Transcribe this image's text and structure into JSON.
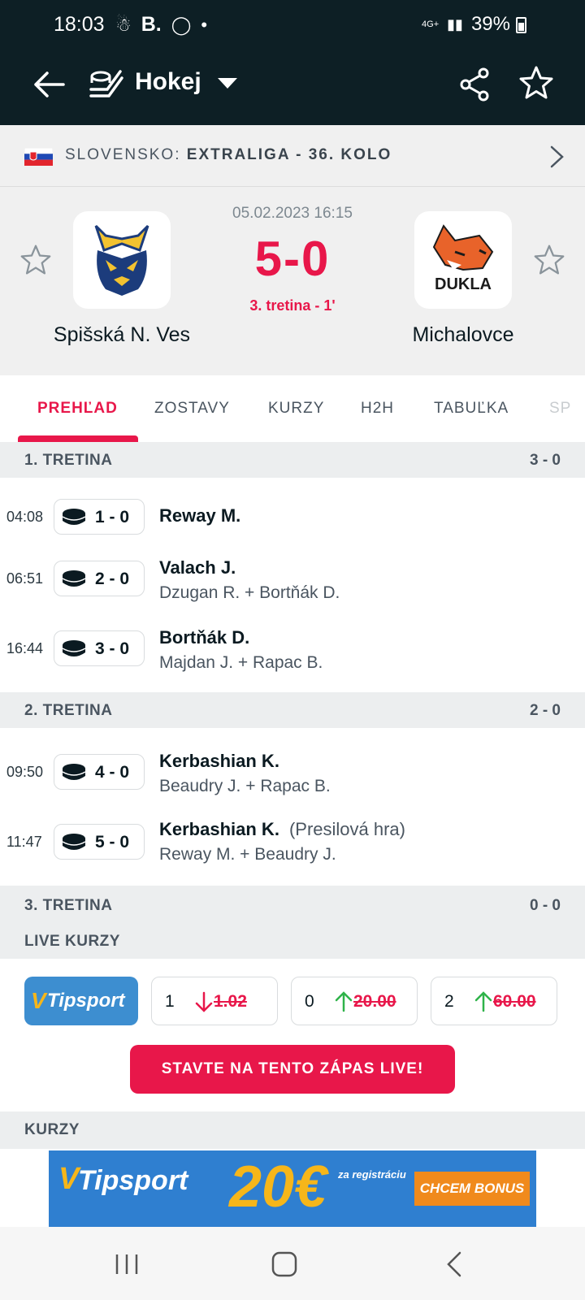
{
  "status_bar": {
    "time": "18:03",
    "network": "4G+",
    "battery": "39%"
  },
  "app_bar": {
    "title": "Hokej"
  },
  "league": {
    "country": "SLOVENSKO:",
    "competition": "EXTRALIGA - 36. KOLO"
  },
  "match": {
    "datetime": "05.02.2023 16:15",
    "score": "5-0",
    "period": "3. tretina - 1'",
    "home_team": "Spišská N. Ves",
    "away_team": "Michalovce",
    "away_logo_text": "DUKLA"
  },
  "tabs": [
    "PREHĽAD",
    "ZOSTAVY",
    "KURZY",
    "H2H",
    "TABUĽKA",
    "SP"
  ],
  "periods": [
    {
      "label": "1. TRETINA",
      "score": "3 - 0"
    },
    {
      "label": "2. TRETINA",
      "score": "2 - 0"
    },
    {
      "label": "3. TRETINA",
      "score": "0 - 0"
    }
  ],
  "events": [
    {
      "time": "04:08",
      "score": "1 - 0",
      "scorer": "Reway M.",
      "note": "",
      "assist": ""
    },
    {
      "time": "06:51",
      "score": "2 - 0",
      "scorer": "Valach J.",
      "note": "",
      "assist": "Dzugan R. + Bortňák D."
    },
    {
      "time": "16:44",
      "score": "3 - 0",
      "scorer": "Bortňák D.",
      "note": "",
      "assist": "Majdan J. + Rapac B."
    },
    {
      "time": "09:50",
      "score": "4 - 0",
      "scorer": "Kerbashian K.",
      "note": "",
      "assist": "Beaudry J. + Rapac B."
    },
    {
      "time": "11:47",
      "score": "5 - 0",
      "scorer": "Kerbashian K.",
      "note": "(Presilová hra)",
      "assist": "Reway M. + Beaudry J."
    }
  ],
  "live_odds": {
    "title": "LIVE KURZY",
    "bookmaker": "Tipsport",
    "odds": [
      {
        "key": "1",
        "value": "1.02",
        "trend": "down"
      },
      {
        "key": "0",
        "value": "20.00",
        "trend": "up"
      },
      {
        "key": "2",
        "value": "60.00",
        "trend": "up"
      }
    ],
    "cta": "STAVTE NA TENTO ZÁPAS LIVE!"
  },
  "odds_section": {
    "title": "KURZY"
  },
  "banner": {
    "brand": "Tipsport",
    "amount": "20€",
    "registration": "za registráciu",
    "bonus": "CHCEM BONUS"
  },
  "colors": {
    "accent": "#e8174a",
    "header_bg": "#0d1f25",
    "odds_up": "#2fb34a",
    "odds_down": "#e8174a"
  }
}
